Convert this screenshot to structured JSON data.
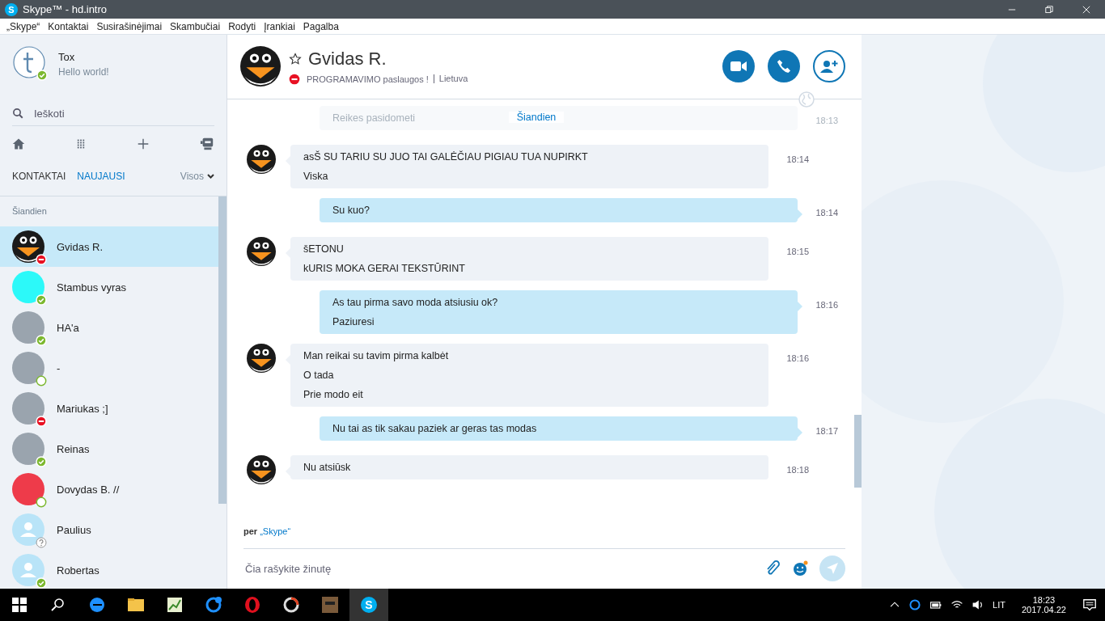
{
  "window": {
    "logo": "S",
    "title": "Skype™ - hd.intro"
  },
  "menu": [
    "„Skype“",
    "Kontaktai",
    "Susirašinėjimai",
    "Skambučiai",
    "Rodyti",
    "Įrankiai",
    "Pagalba"
  ],
  "profile": {
    "name": "Tox",
    "mood": "Hello world!",
    "presence": {
      "kind": "online"
    }
  },
  "search": {
    "placeholder": "Ieškoti"
  },
  "tabs": [
    {
      "label": "KONTAKTAI",
      "selected": false
    },
    {
      "label": "NAUJAUSI",
      "selected": true
    }
  ],
  "filter": "Visos",
  "section_label": "Šiandien",
  "contacts": [
    {
      "name": "Gvidas R.",
      "avatar": {
        "kind": "penguin"
      },
      "presence": {
        "kind": "busy"
      },
      "selected": true
    },
    {
      "name": "Stambus vyras",
      "avatar": {
        "kind": "color",
        "color": "#2cf9f9"
      },
      "presence": {
        "kind": "online"
      },
      "selected": false
    },
    {
      "name": "HA'a",
      "avatar": {
        "kind": "photo"
      },
      "presence": {
        "kind": "online"
      },
      "selected": false
    },
    {
      "name": "-",
      "avatar": {
        "kind": "photo"
      },
      "presence": {
        "kind": "offline"
      },
      "selected": false
    },
    {
      "name": "Mariukas ;]",
      "avatar": {
        "kind": "photo"
      },
      "presence": {
        "kind": "busy"
      },
      "selected": false
    },
    {
      "name": "Reinas",
      "avatar": {
        "kind": "photo"
      },
      "presence": {
        "kind": "online"
      },
      "selected": false
    },
    {
      "name": "Dovydas B. //",
      "avatar": {
        "kind": "color",
        "color": "#ee3b4a"
      },
      "presence": {
        "kind": "offline"
      },
      "selected": false
    },
    {
      "name": "Paulius",
      "avatar": {
        "kind": "default"
      },
      "presence": {
        "kind": "unknown"
      },
      "selected": false
    },
    {
      "name": "Robertas",
      "avatar": {
        "kind": "default"
      },
      "presence": {
        "kind": "online"
      },
      "selected": false
    }
  ],
  "chat": {
    "name": "Gvidas R.",
    "presence": {
      "kind": "busy"
    },
    "mood": "PROGRAMAVIMO paslaugos !",
    "location": "Lietuva",
    "date_divider": "Šiandien"
  },
  "messages": [
    {
      "kind": "faded",
      "lines": [
        "Reikes pasidometi"
      ],
      "time": "18:13"
    },
    {
      "kind": "incoming",
      "lines": [
        "asŠ SU TARIU SU JUO TAI GALĖČIAU PIGIAU TUA NUPIRKT",
        "Viska"
      ],
      "time": "18:14"
    },
    {
      "kind": "outgoing",
      "lines": [
        "Su kuo?"
      ],
      "time": "18:14"
    },
    {
      "kind": "incoming",
      "lines": [
        "šETONU",
        "kURIS MOKA GERAI TEKSTŪRINT"
      ],
      "time": "18:15"
    },
    {
      "kind": "outgoing",
      "lines": [
        "As tau pirma savo moda atsiusiu ok?",
        "Paziuresi"
      ],
      "time": "18:16"
    },
    {
      "kind": "incoming",
      "lines": [
        "Man reikai su tavim pirma kalbėt",
        "O tada",
        "Prie modo eit"
      ],
      "time": "18:16"
    },
    {
      "kind": "outgoing",
      "lines": [
        "Nu tai as tik sakau paziek ar geras tas modas"
      ],
      "time": "18:17"
    },
    {
      "kind": "incoming",
      "lines": [
        "Nu atsiūsk"
      ],
      "time": "18:18"
    }
  ],
  "via": {
    "prefix": "per",
    "link": "„Skype“"
  },
  "composer": {
    "placeholder": "Čia rašykite žinutę"
  },
  "taskbar": {
    "skype_logo": "S",
    "language": "LIT",
    "time": "18:23",
    "date": "2017.04.22"
  }
}
